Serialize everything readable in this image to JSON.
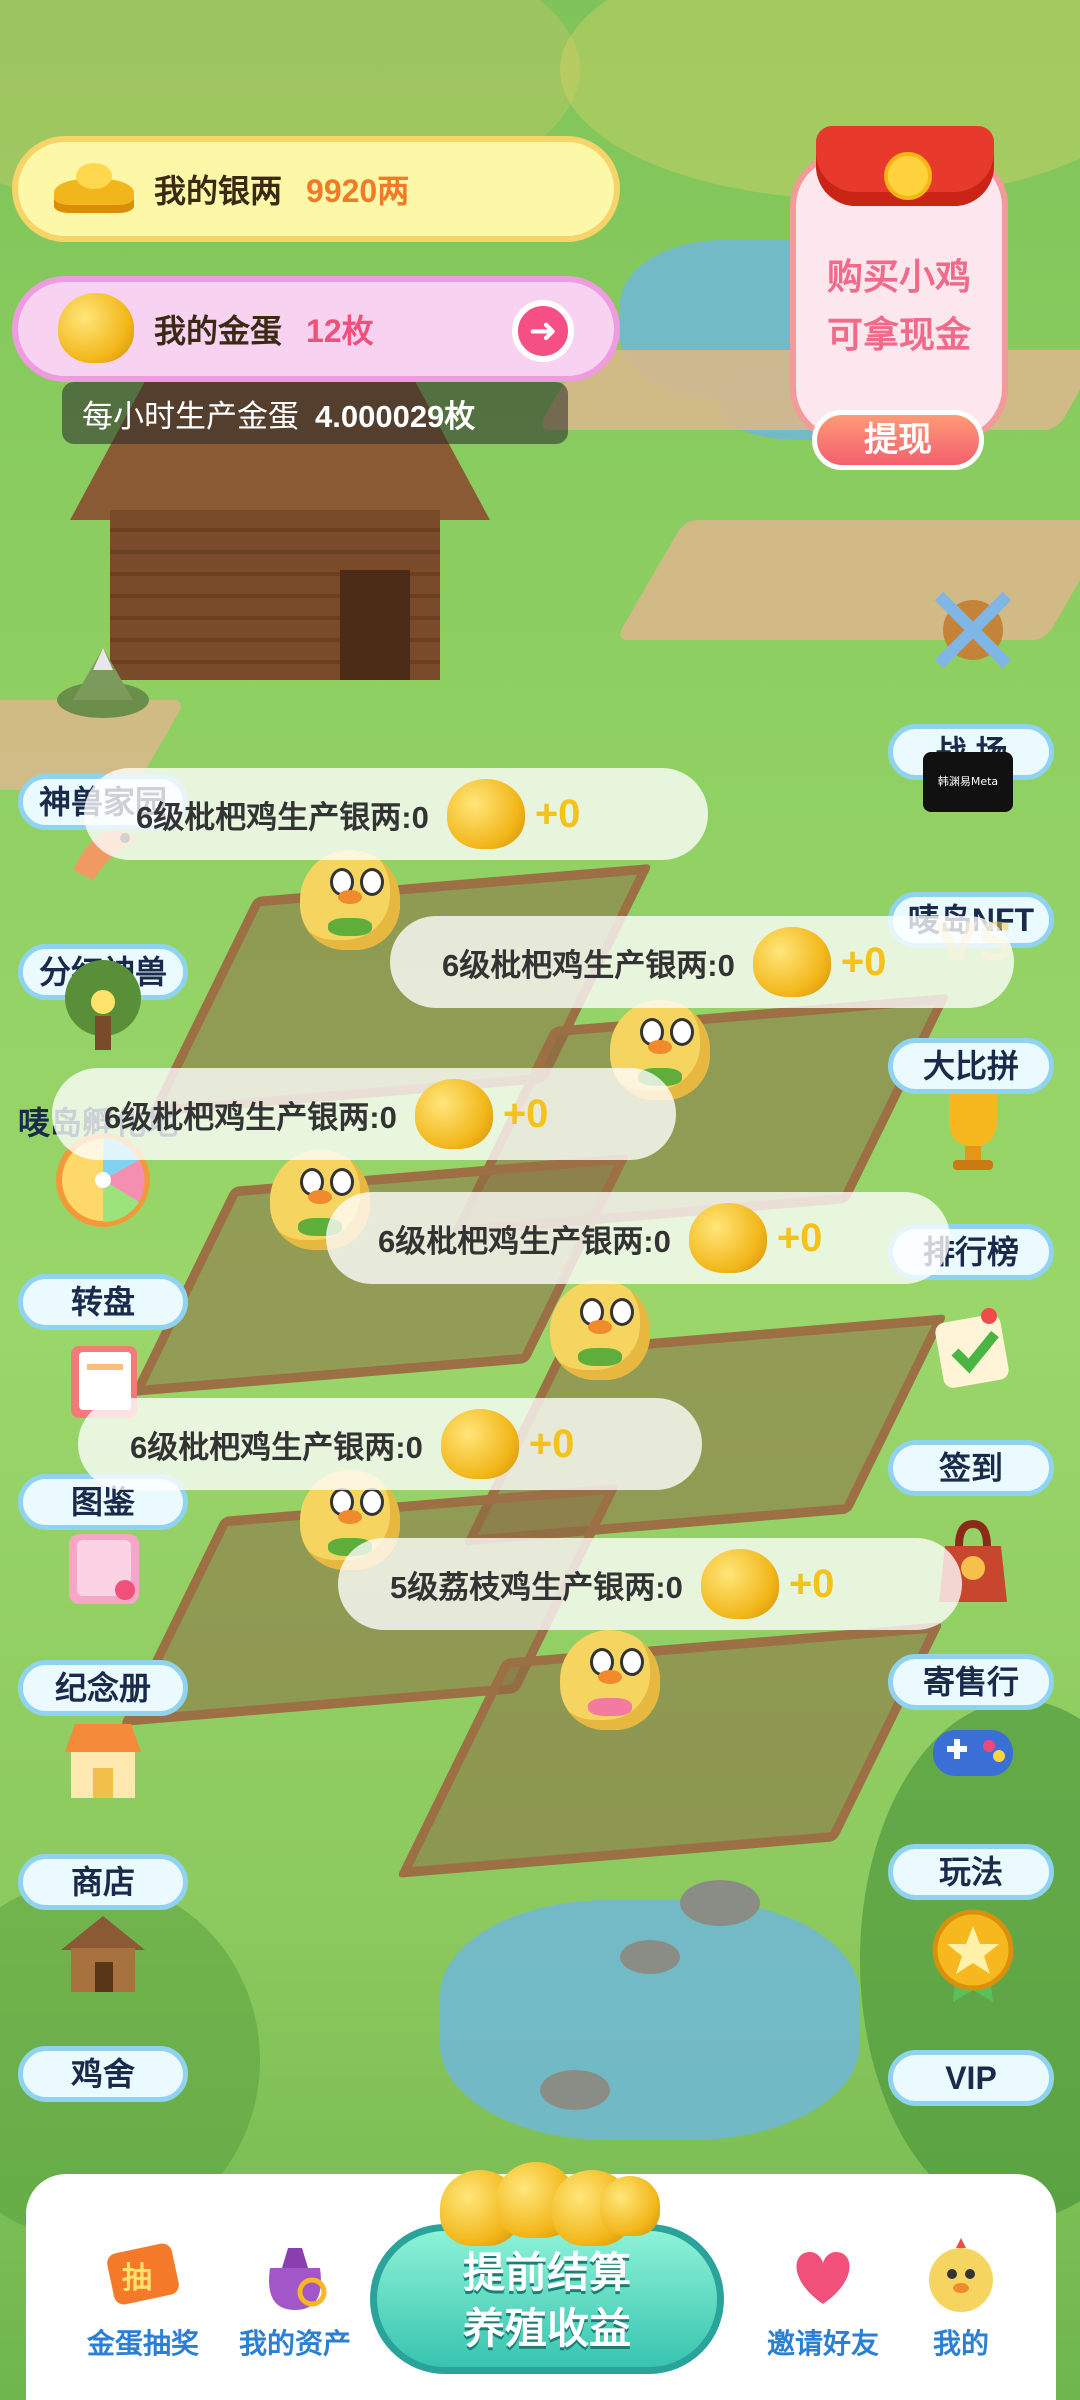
{
  "resources": {
    "silver": {
      "label": "我的银两",
      "value": "9920两"
    },
    "gold_egg": {
      "label": "我的金蛋",
      "value": "12枚"
    },
    "hourly": {
      "label": "每小时生产金蛋",
      "value": "4.000029枚"
    }
  },
  "red_packet": {
    "line1": "购买小鸡",
    "line2": "可拿现金",
    "button": "提现"
  },
  "left_menu": [
    {
      "label": "神兽家园",
      "icon": "island-icon"
    },
    {
      "label": "分红神兽",
      "icon": "shrimp-icon"
    },
    {
      "label": "唛岛孵化地",
      "icon": "tree-icon"
    },
    {
      "label": "转盘",
      "icon": "wheel-icon"
    },
    {
      "label": "图鉴",
      "icon": "book-icon"
    },
    {
      "label": "纪念册",
      "icon": "album-icon"
    },
    {
      "label": "商店",
      "icon": "shop-icon"
    },
    {
      "label": "鸡舍",
      "icon": "coop-icon"
    }
  ],
  "right_menu": [
    {
      "label": "战 场",
      "icon": "swords-icon"
    },
    {
      "label": "唛岛NFT",
      "icon": "meta-icon",
      "badge": "韩渊易Meta"
    },
    {
      "label": "大比拼",
      "icon": "vs-icon"
    },
    {
      "label": "排行榜",
      "icon": "trophy-icon"
    },
    {
      "label": "签到",
      "icon": "checkin-icon"
    },
    {
      "label": "寄售行",
      "icon": "bag-icon"
    },
    {
      "label": "玩法",
      "icon": "gamepad-icon"
    },
    {
      "label": "VIP",
      "icon": "vip-star-icon"
    }
  ],
  "production": [
    {
      "text": "6级枇杷鸡生产银两:0",
      "value": "+0"
    },
    {
      "text": "6级枇杷鸡生产银两:0",
      "value": "+0"
    },
    {
      "text": "6级枇杷鸡生产银两:0",
      "value": "+0"
    },
    {
      "text": "6级枇杷鸡生产银两:0",
      "value": "+0"
    },
    {
      "text": "6级枇杷鸡生产银两:0",
      "value": "+0"
    },
    {
      "text": "5级荔枝鸡生产银两:0",
      "value": "+0"
    }
  ],
  "bottom_nav": {
    "lottery": "金蛋抽奖",
    "assets": "我的资产",
    "settle_line1": "提前结算",
    "settle_line2": "养殖收益",
    "invite": "邀请好友",
    "mine": "我的"
  }
}
